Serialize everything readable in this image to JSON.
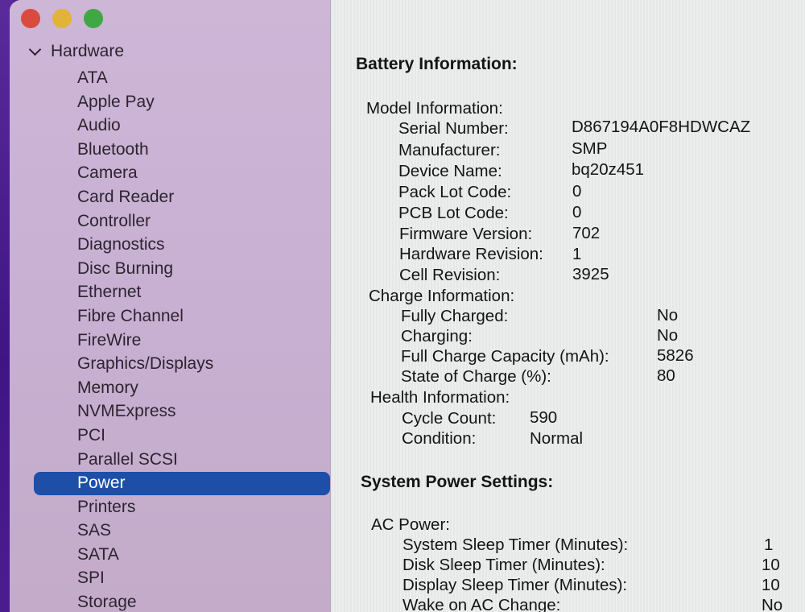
{
  "window": {
    "controls": [
      "close",
      "minimize",
      "zoom"
    ]
  },
  "sidebar": {
    "section": "Hardware",
    "items": [
      {
        "label": "ATA"
      },
      {
        "label": "Apple Pay"
      },
      {
        "label": "Audio"
      },
      {
        "label": "Bluetooth"
      },
      {
        "label": "Camera"
      },
      {
        "label": "Card Reader"
      },
      {
        "label": "Controller"
      },
      {
        "label": "Diagnostics"
      },
      {
        "label": "Disc Burning"
      },
      {
        "label": "Ethernet"
      },
      {
        "label": "Fibre Channel"
      },
      {
        "label": "FireWire"
      },
      {
        "label": "Graphics/Displays"
      },
      {
        "label": "Memory"
      },
      {
        "label": "NVMExpress"
      },
      {
        "label": "PCI"
      },
      {
        "label": "Parallel SCSI"
      },
      {
        "label": "Power",
        "selected": true
      },
      {
        "label": "Printers"
      },
      {
        "label": "SAS"
      },
      {
        "label": "SATA"
      },
      {
        "label": "SPI"
      },
      {
        "label": "Storage"
      }
    ],
    "selected_color": "#1d4fa8"
  },
  "battery": {
    "title": "Battery Information:",
    "model": {
      "heading": "Model Information:",
      "rows": [
        {
          "label": "Serial Number:",
          "value": "D867194A0F8HDWCAZ"
        },
        {
          "label": "Manufacturer:",
          "value": "SMP"
        },
        {
          "label": "Device Name:",
          "value": "bq20z451"
        },
        {
          "label": "Pack Lot Code:",
          "value": "0"
        },
        {
          "label": "PCB Lot Code:",
          "value": "0"
        },
        {
          "label": "Firmware Version:",
          "value": "702"
        },
        {
          "label": "Hardware Revision:",
          "value": "1"
        },
        {
          "label": "Cell Revision:",
          "value": "3925"
        }
      ]
    },
    "charge": {
      "heading": "Charge Information:",
      "rows": [
        {
          "label": "Fully Charged:",
          "value": "No"
        },
        {
          "label": "Charging:",
          "value": "No"
        },
        {
          "label": "Full Charge Capacity (mAh):",
          "value": "5826"
        },
        {
          "label": "State of Charge (%):",
          "value": "80"
        }
      ]
    },
    "health": {
      "heading": "Health Information:",
      "rows": [
        {
          "label": "Cycle Count:",
          "value": "590"
        },
        {
          "label": "Condition:",
          "value": "Normal"
        }
      ]
    }
  },
  "power_settings": {
    "title": "System Power Settings:",
    "ac": {
      "heading": "AC Power:",
      "rows": [
        {
          "label": "System Sleep Timer (Minutes):",
          "value": "1"
        },
        {
          "label": "Disk Sleep Timer (Minutes):",
          "value": "10"
        },
        {
          "label": "Display Sleep Timer (Minutes):",
          "value": "10"
        },
        {
          "label": "Wake on AC Change:",
          "value": "No"
        }
      ]
    }
  }
}
